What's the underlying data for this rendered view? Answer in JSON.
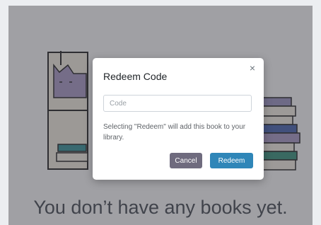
{
  "background": {
    "empty_state_title": "You don’t have any books yet."
  },
  "modal": {
    "title": "Redeem Code",
    "close_label": "×",
    "code_input": {
      "placeholder": "Code",
      "value": ""
    },
    "help_text": "Selecting \"Redeem\" will add this book to your library.",
    "cancel_label": "Cancel",
    "redeem_label": "Redeem"
  },
  "colors": {
    "primary_button": "#2f86b8",
    "secondary_button": "#6f6b7e",
    "overlay": "rgba(25,25,35,0.40)"
  },
  "icons": {
    "close": "close-icon",
    "illustration": "bookshelf-cat-illustration"
  }
}
